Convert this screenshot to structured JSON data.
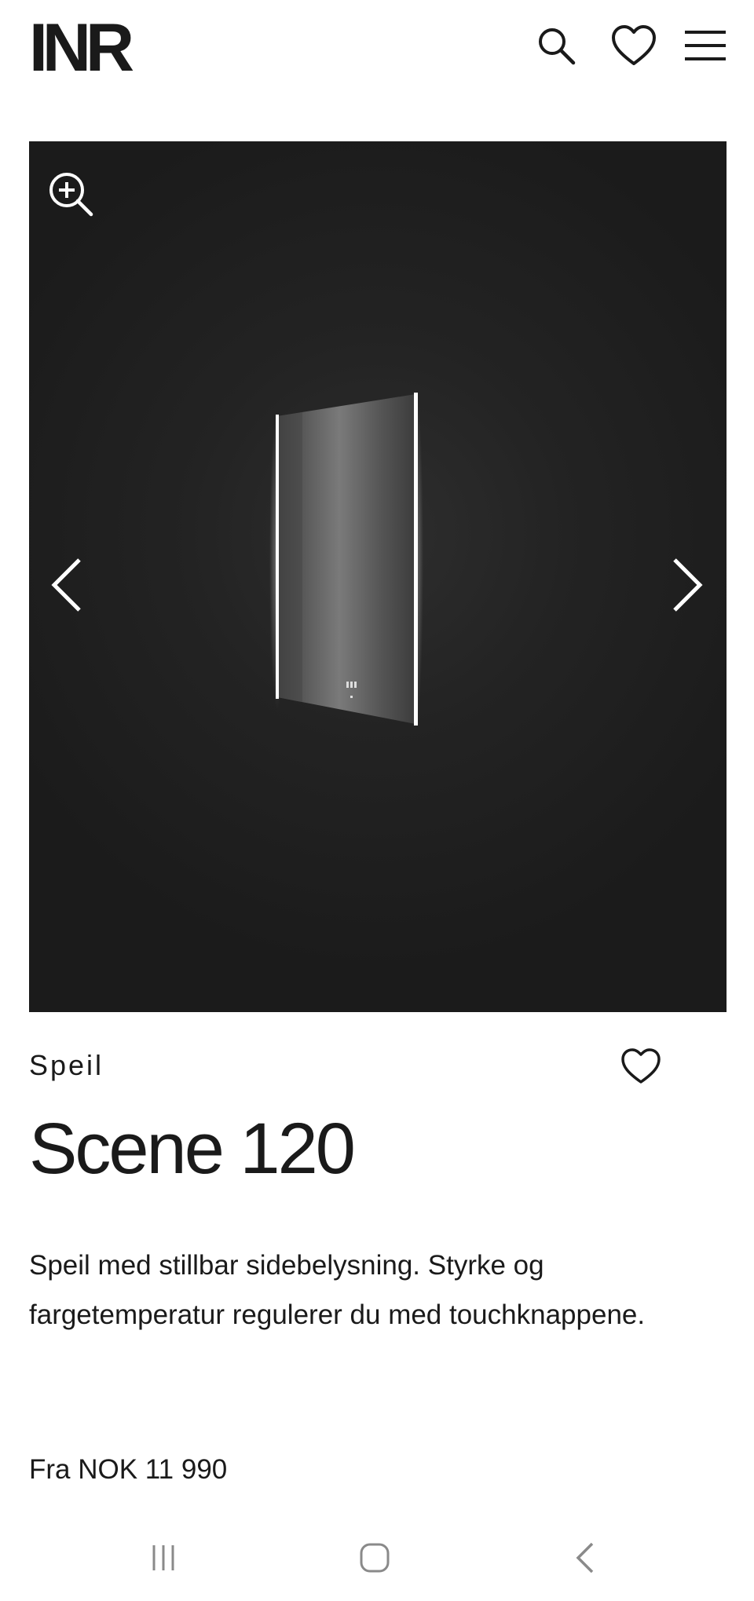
{
  "header": {
    "logo": "INR",
    "icons": [
      "search-icon",
      "heart-icon",
      "menu-icon"
    ]
  },
  "gallery": {
    "icons": [
      "zoom-in-icon",
      "chevron-left-icon",
      "chevron-right-icon"
    ]
  },
  "product": {
    "category": "Speil",
    "title": "Scene 120",
    "description": "Speil med stillbar sidebelysning. Styrke og fargetemperatur regulerer du med touchknappene.",
    "price": "Fra NOK 11 990",
    "favorite_icon": "heart-outline-icon"
  },
  "navbar": {
    "icons": [
      "recent-apps-icon",
      "home-icon",
      "back-icon"
    ]
  },
  "colors": {
    "text": "#1a1a1a",
    "gallery_background": "#1e1e1e",
    "navbar_icons": "#8a8a8a"
  }
}
